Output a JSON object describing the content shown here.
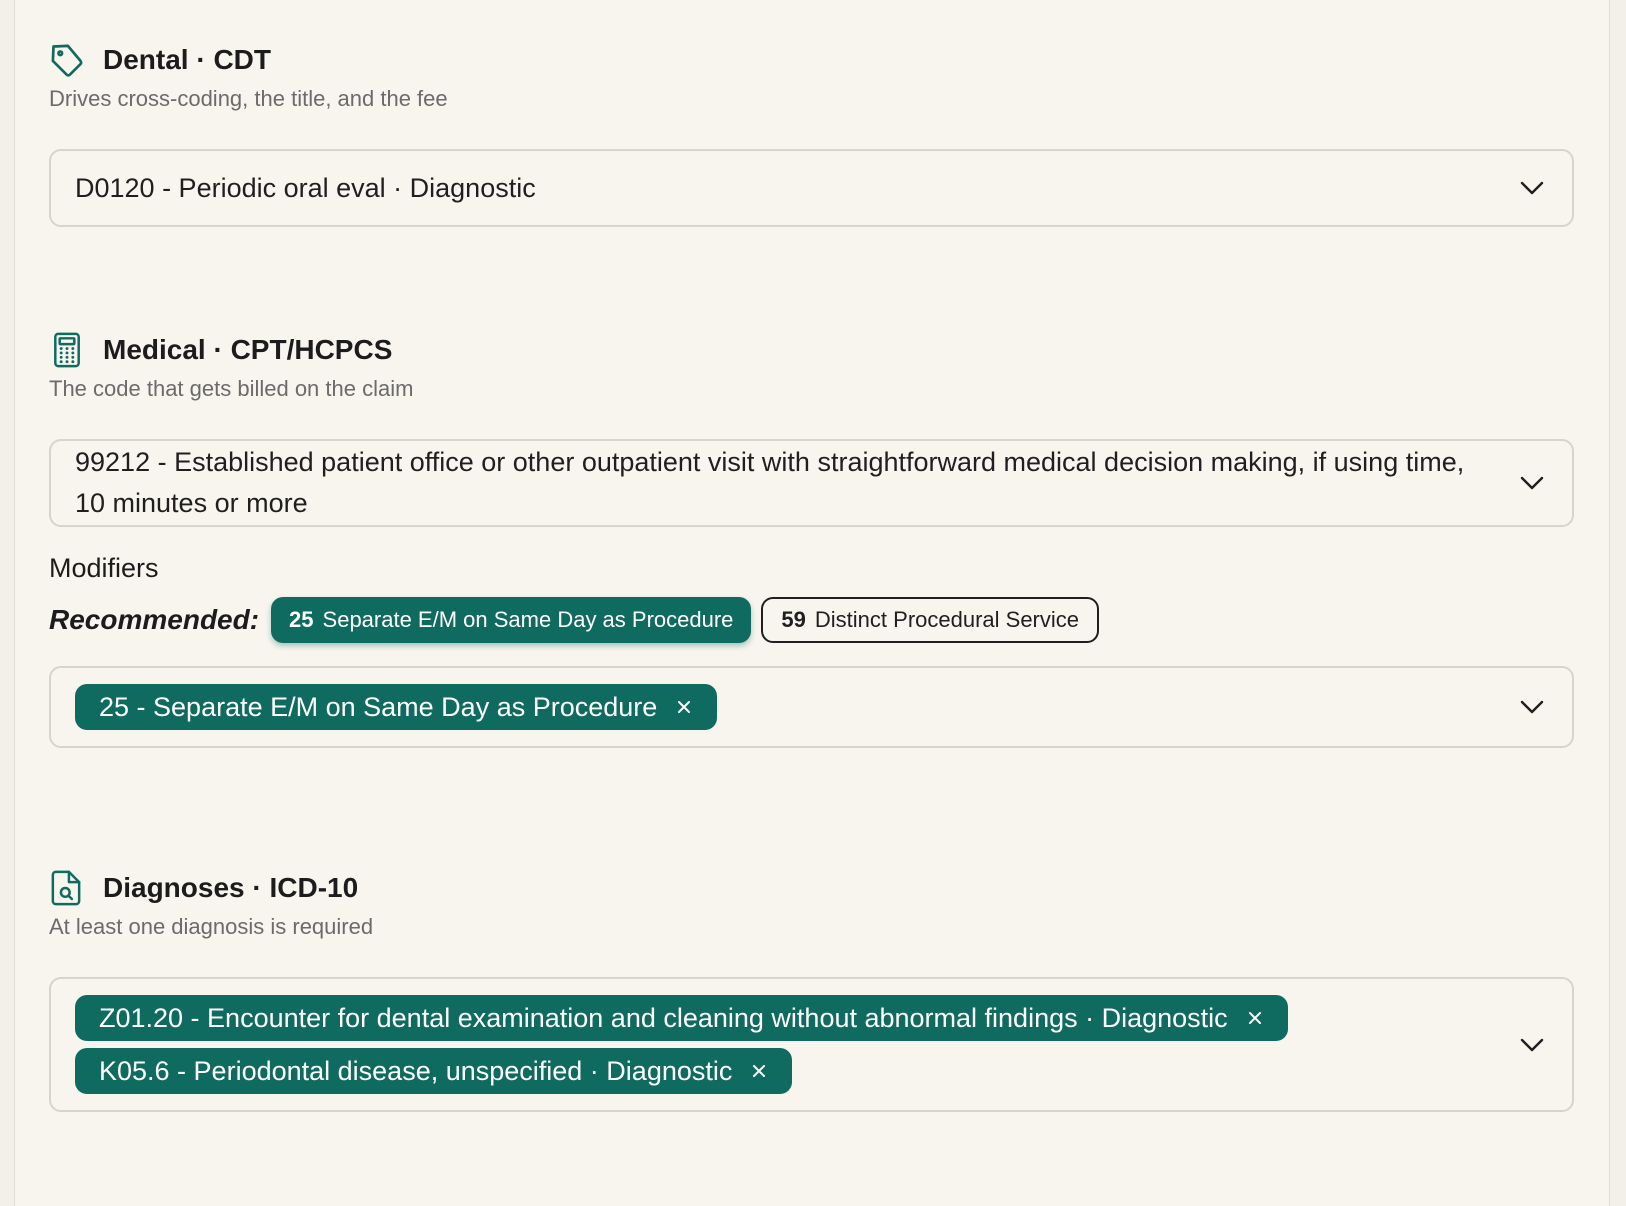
{
  "colors": {
    "accent": "#0f6b5f",
    "background": "#f8f5ef",
    "text": "#1f1f1f",
    "muted": "#6b6b6b",
    "border": "#d8d4cc"
  },
  "dental": {
    "icon": "tag-icon",
    "title": "Dental · CDT",
    "subtitle": "Drives cross-coding, the title, and the fee",
    "selected": "D0120 - Periodic oral eval · Diagnostic"
  },
  "medical": {
    "icon": "calculator-icon",
    "title": "Medical · CPT/HCPCS",
    "subtitle": "The code that gets billed on the claim",
    "selected": "99212 - Established patient office or other outpatient visit with straightforward medical decision making, if using time, 10 minutes or more",
    "modifiers_label": "Modifiers",
    "recommended_label": "Recommended:",
    "recommended": [
      {
        "code": "25",
        "label": "Separate E/M on Same Day as Procedure",
        "selected": true
      },
      {
        "code": "59",
        "label": "Distinct Procedural Service",
        "selected": false
      }
    ],
    "selected_modifiers": [
      {
        "label": "25 - Separate E/M on Same Day as Procedure"
      }
    ]
  },
  "diagnoses": {
    "icon": "file-search-icon",
    "title": "Diagnoses · ICD-10",
    "subtitle": "At least one diagnosis is required",
    "selected": [
      {
        "label": "Z01.20 - Encounter for dental examination and cleaning without abnormal findings · Diagnostic"
      },
      {
        "label": "K05.6 - Periodontal disease, unspecified · Diagnostic"
      }
    ]
  }
}
